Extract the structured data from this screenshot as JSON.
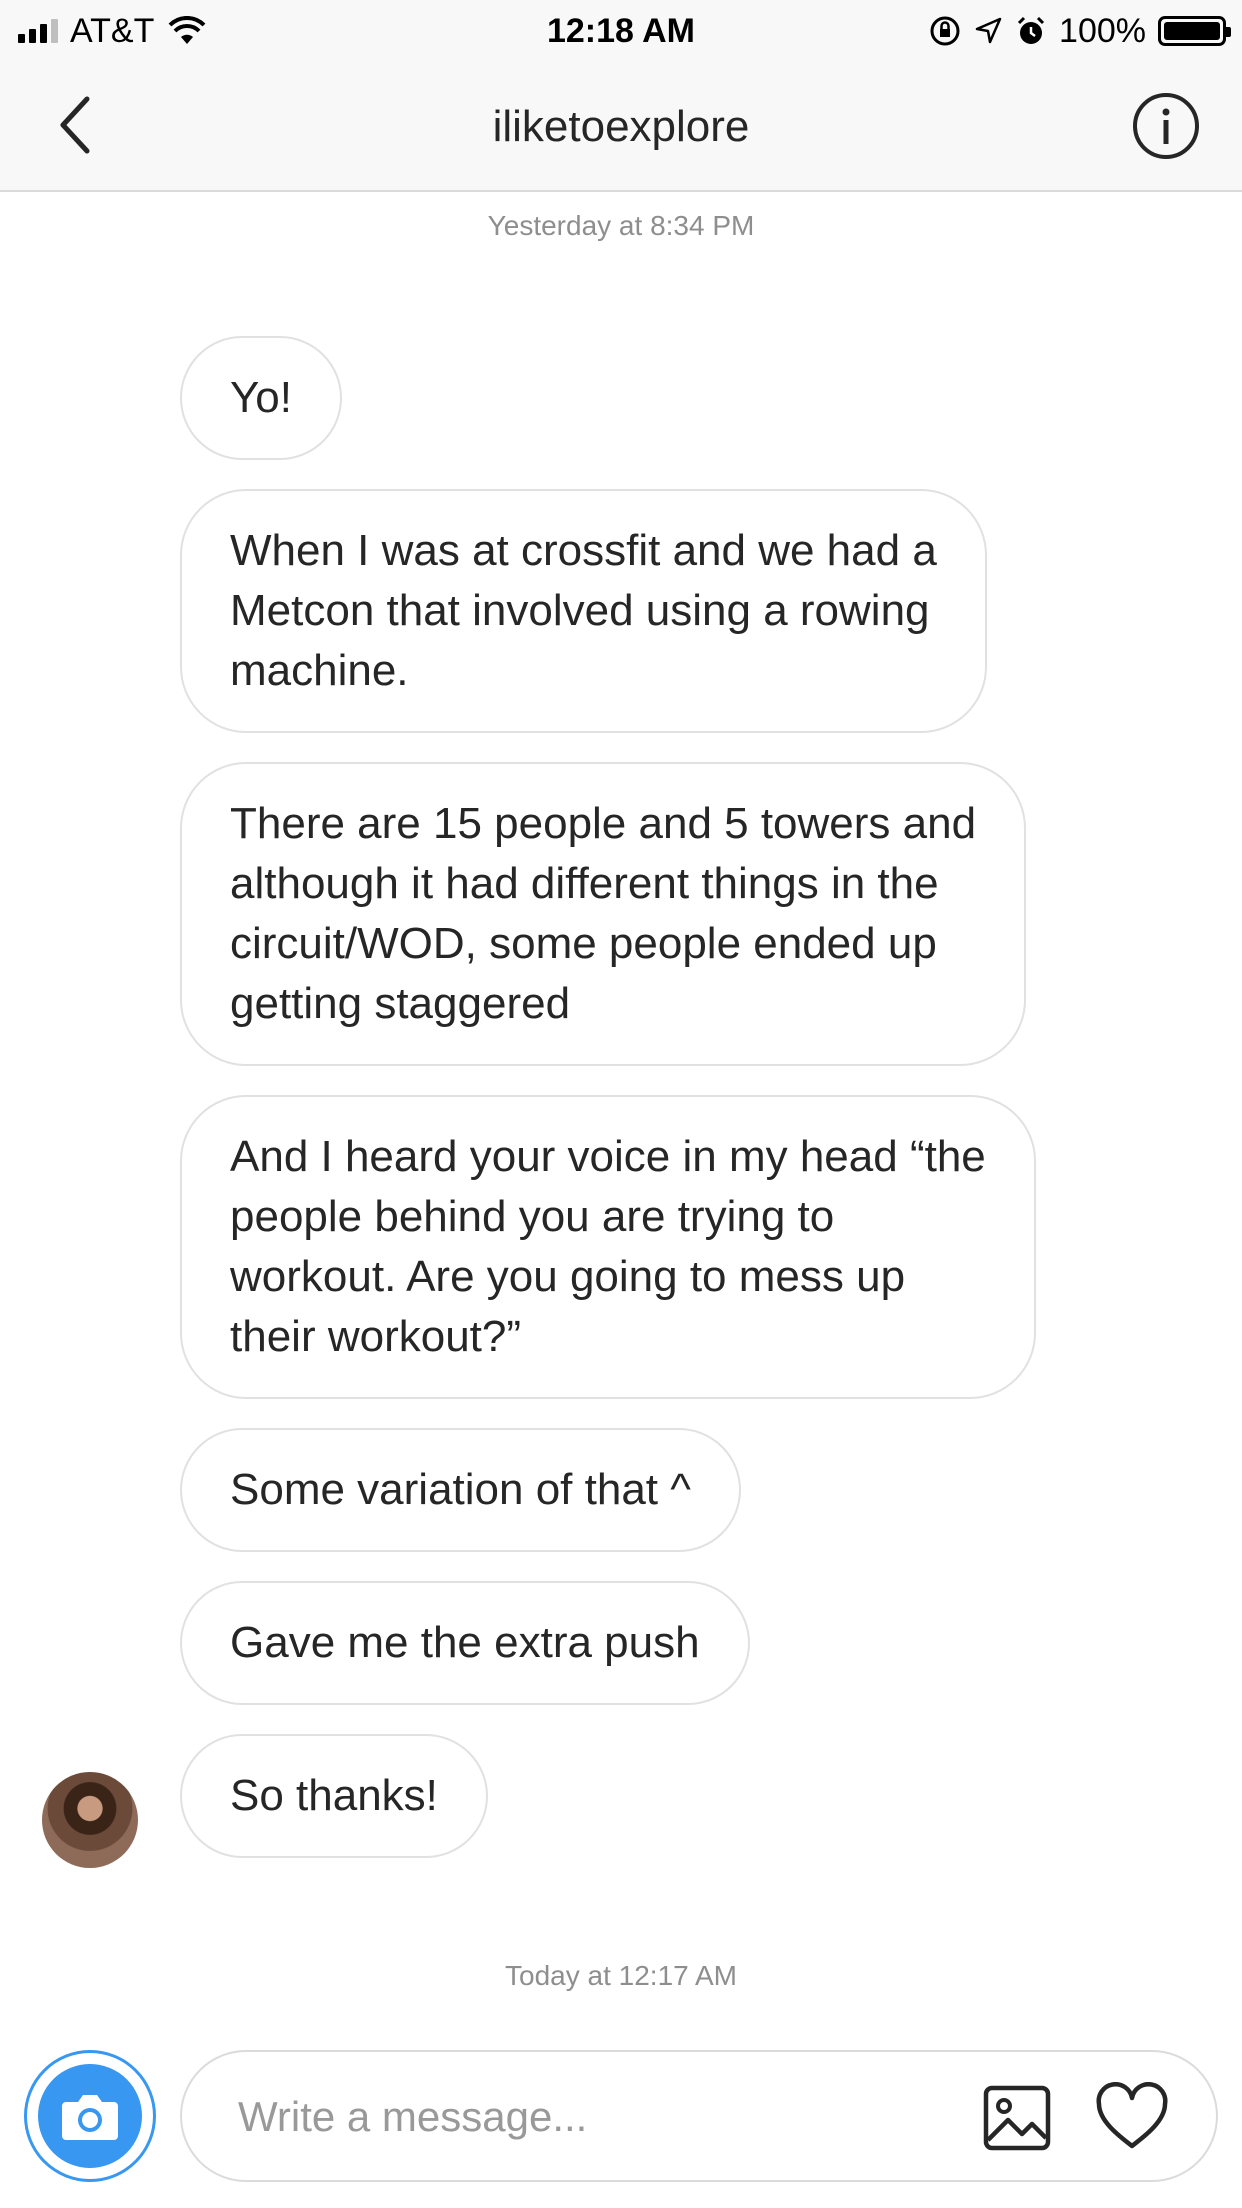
{
  "status_bar": {
    "carrier": "AT&T",
    "time": "12:18 AM",
    "battery": "100%"
  },
  "header": {
    "title": "iliketoexplore"
  },
  "conversation": {
    "timestamp_top": "Yesterday at 8:34 PM",
    "messages": [
      {
        "text": "Yo!"
      },
      {
        "text": "When I was at crossfit and we had a\nMetcon that involved using a rowing\nmachine."
      },
      {
        "text": "There are 15 people and 5 towers and\nalthough it had different things in the\ncircuit/WOD, some people ended up\ngetting staggered"
      },
      {
        "text": "And I heard your voice in my head “the\npeople behind you are trying to\nworkout. Are you going to mess up\ntheir workout?”"
      },
      {
        "text": "Some variation of that ^"
      },
      {
        "text": "Gave me the extra push"
      },
      {
        "text": "So thanks!"
      }
    ],
    "timestamp_bottom": "Today at 12:17 AM"
  },
  "composer": {
    "placeholder": "Write a message..."
  },
  "colors": {
    "accent": "#3897f0",
    "bubble_border": "#e1e1e1",
    "timestamp": "#8e8e8e"
  }
}
